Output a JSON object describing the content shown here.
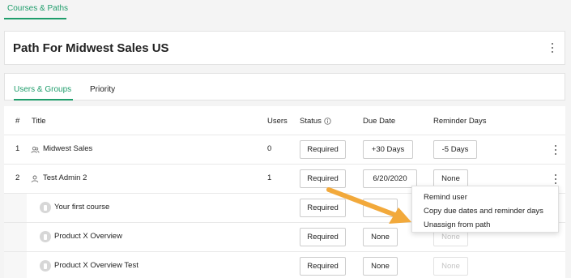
{
  "breadcrumb": {
    "label": "Courses & Paths"
  },
  "page": {
    "title": "Path For Midwest Sales US"
  },
  "tabs": [
    {
      "label": "Users & Groups",
      "active": true
    },
    {
      "label": "Priority",
      "active": false
    }
  ],
  "table": {
    "headers": {
      "num": "#",
      "title": "Title",
      "users": "Users",
      "status": "Status",
      "due": "Due Date",
      "reminder": "Reminder Days"
    },
    "rows": [
      {
        "num": "1",
        "title": "Midwest Sales",
        "icon": "group-icon",
        "users": "0",
        "status": "Required",
        "due": "+30 Days",
        "reminder": "-5 Days"
      },
      {
        "num": "2",
        "title": "Test Admin 2",
        "icon": "user-icon",
        "users": "1",
        "status": "Required",
        "due": "6/20/2020",
        "reminder": "None"
      }
    ],
    "courses": [
      {
        "title": "Your first course",
        "status": "Required",
        "due": "",
        "reminder": ""
      },
      {
        "title": "Product X Overview",
        "status": "Required",
        "due": "None",
        "reminder": "None"
      },
      {
        "title": "Product X Overview Test",
        "status": "Required",
        "due": "None",
        "reminder": "None"
      }
    ]
  },
  "context_menu": {
    "items": [
      "Remind user",
      "Copy due dates and reminder days",
      "Unassign from path"
    ]
  },
  "colors": {
    "accent": "#1f9d6b",
    "annotation_arrow": "#f2a93b"
  }
}
